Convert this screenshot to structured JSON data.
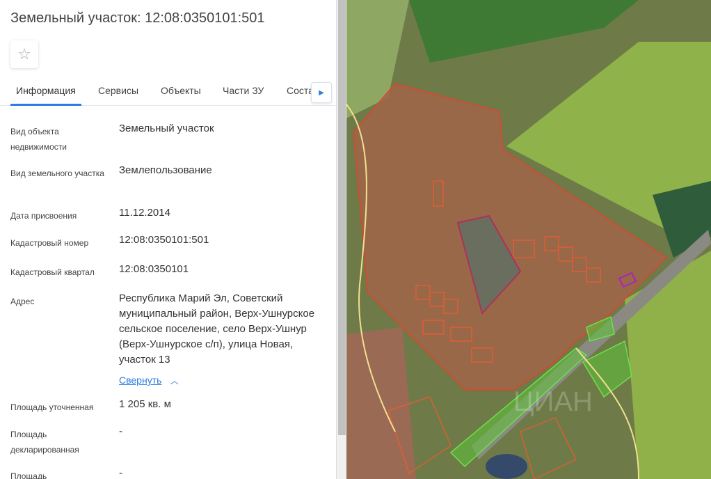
{
  "title": "Земельный участок: 12:08:0350101:501",
  "tabs": [
    "Информация",
    "Сервисы",
    "Объекты",
    "Части ЗУ",
    "Состав ЕЗП"
  ],
  "fields": [
    {
      "label": "Вид объекта недвижимости",
      "value": "Земельный участок"
    },
    {
      "label": "Вид земельного участка",
      "value": "Землепользование"
    },
    {
      "label": "Дата присвоения",
      "value": "11.12.2014"
    },
    {
      "label": "Кадастровый номер",
      "value": "12:08:0350101:501"
    },
    {
      "label": "Кадастровый квартал",
      "value": "12:08:0350101"
    },
    {
      "label": "Адрес",
      "value": "Республика Марий Эл, Советский муниципальный район, Верх-Ушнурское сельское поселение, село Верх-Ушнур (Верх-Ушнурское с/п), улица Новая, участок 13"
    },
    {
      "label": "Площадь уточненная",
      "value": "1 205 кв. м"
    },
    {
      "label": "Площадь декларированная",
      "value": "-"
    },
    {
      "label": "Площадь",
      "value": "-"
    }
  ],
  "collapse_link": "Свернуть",
  "watermark": "ЦИАН 8 (929) ... 066",
  "colors": {
    "accent": "#2b7de1",
    "parcel": "#e0452a",
    "green": "#6ee04a"
  }
}
